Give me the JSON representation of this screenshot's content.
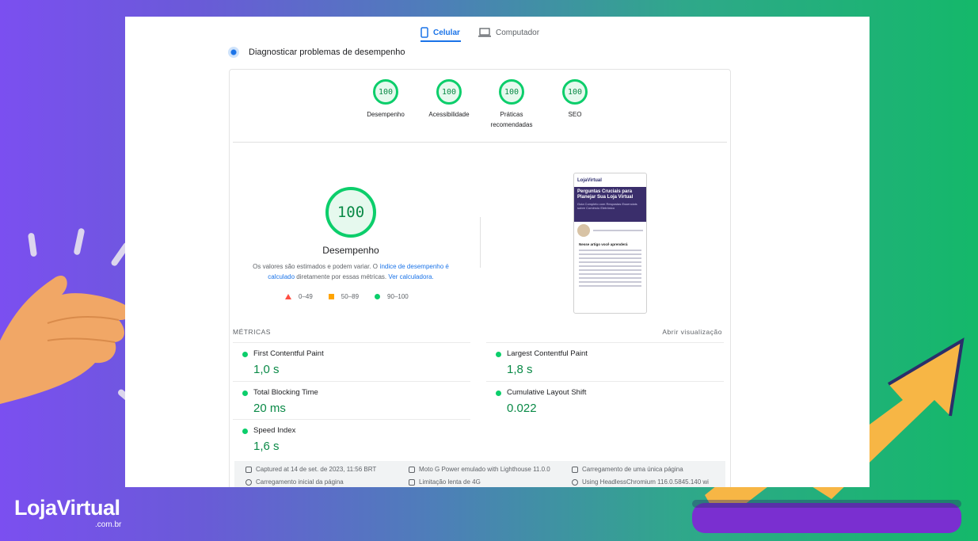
{
  "tabs": [
    {
      "label": "Celular",
      "active": true
    },
    {
      "label": "Computador",
      "active": false
    }
  ],
  "diagnose_title": "Diagnosticar problemas de desempenho",
  "scores": [
    {
      "value": "100",
      "label": "Desempenho"
    },
    {
      "value": "100",
      "label": "Acessibilidade"
    },
    {
      "value": "100",
      "label": "Práticas recomendadas"
    },
    {
      "value": "100",
      "label": "SEO"
    }
  ],
  "main_score": {
    "value": "100",
    "label": "Desempenho"
  },
  "disclaimer": {
    "text1": "Os valores são estimados e podem variar. O",
    "link1": "índice de desempenho é calculado",
    "text2": "diretamente por essas métricas.",
    "link2": "Ver calculadora."
  },
  "legend": [
    {
      "range": "0–49",
      "color": "#ff4e42"
    },
    {
      "range": "50–89",
      "color": "#ffa400"
    },
    {
      "range": "90–100",
      "color": "#0cce6b"
    }
  ],
  "preview": {
    "brand": "LojaVirtual",
    "title": "Perguntas Cruciais para Planejar Sua Loja Virtual",
    "subtitle": "Guia Completo com Respostas Essenciais sobre Comércio Eletrônico",
    "section": "Nesse artigo você aprenderá"
  },
  "metrics_header": "MÉTRICAS",
  "expand_label": "Abrir visualização",
  "metrics": [
    {
      "name": "First Contentful Paint",
      "value": "1,0 s"
    },
    {
      "name": "Largest Contentful Paint",
      "value": "1,8 s"
    },
    {
      "name": "Total Blocking Time",
      "value": "20 ms"
    },
    {
      "name": "Cumulative Layout Shift",
      "value": "0.022"
    },
    {
      "name": "Speed Index",
      "value": "1,6 s"
    }
  ],
  "footer": [
    "Captured at 14 de set. de 2023, 11:56 BRT",
    "Moto G Power emulado with Lighthouse 11.0.0",
    "Carregamento de uma única página",
    "Carregamento inicial da página",
    "Limitação lenta de 4G",
    "Using HeadlessChromium 116.0.5845.140 wi"
  ],
  "logo": {
    "main": "LojaVirtual",
    "sub": ".com.br"
  },
  "colors": {
    "pass": "#0cce6b",
    "link": "#1a73e8",
    "purple_bar": "#7a2fd0",
    "arrow": "#f7b645"
  }
}
